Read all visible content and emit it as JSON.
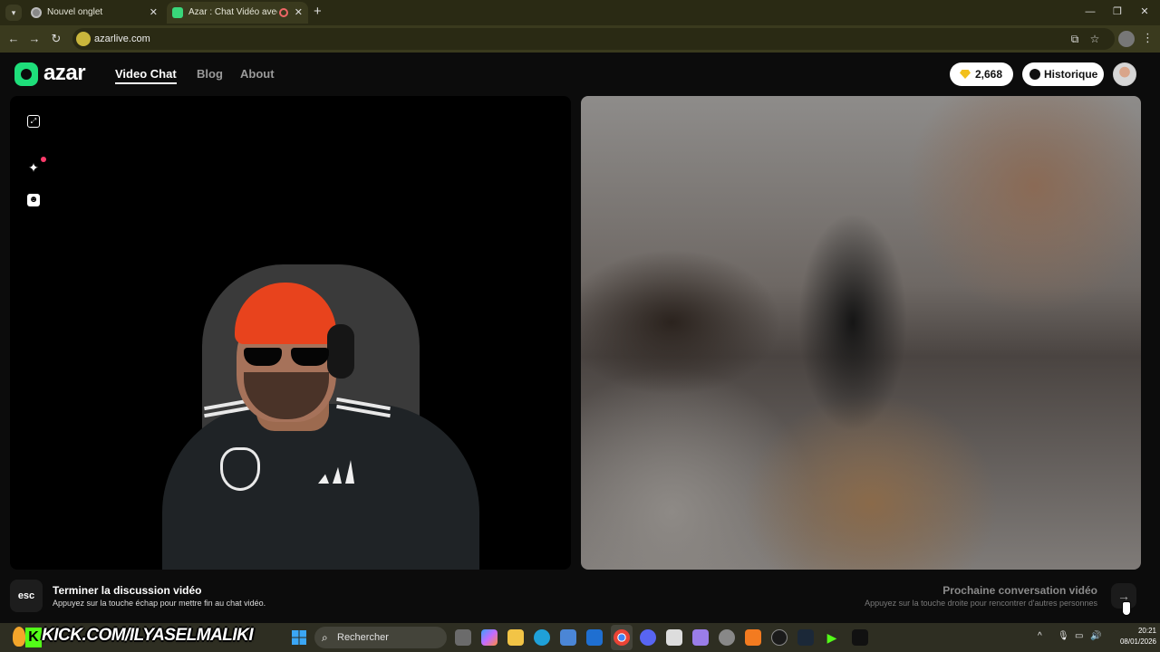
{
  "browser": {
    "tabs": [
      {
        "title": "Nouvel onglet"
      },
      {
        "title": "Azar : Chat Vidéo avec de n"
      }
    ],
    "url": "azarlive.com"
  },
  "app": {
    "logo_text": "azar",
    "nav": [
      {
        "label": "Video Chat",
        "active": true
      },
      {
        "label": "Blog",
        "active": false
      },
      {
        "label": "About",
        "active": false
      }
    ],
    "gems": "2,668",
    "history_label": "Historique",
    "side_icons": [
      "expand-icon",
      "sparkles-effects-icon",
      "face-mask-icon"
    ]
  },
  "bottom": {
    "esc_key": "esc",
    "end_title": "Terminer la discussion vidéo",
    "end_desc": "Appuyez sur la touche échap pour mettre fin au chat vidéo.",
    "next_title": "Prochaine conversation vidéo",
    "next_desc": "Appuyez sur la touche droite pour rencontrer d'autres personnes"
  },
  "overlay": {
    "kick_text": "KICK.COM/ILYASELMALIKI"
  },
  "taskbar": {
    "search_placeholder": "Rechercher",
    "time": "20:21",
    "date": "08/01/2026"
  },
  "colors": {
    "brand": "#1ede7a",
    "kick": "#53fc18",
    "gem": "#f2c01c"
  }
}
